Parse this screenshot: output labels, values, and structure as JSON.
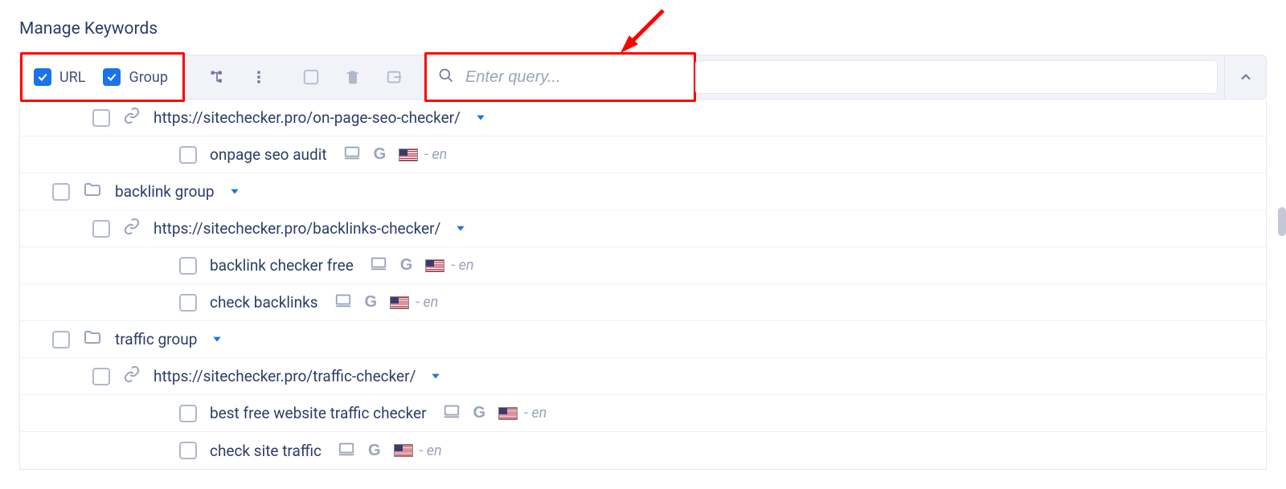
{
  "title": "Manage Keywords",
  "toolbar": {
    "url_label": "URL",
    "group_label": "Group",
    "search_placeholder": "Enter query..."
  },
  "locale_suffix": "- en",
  "tree": [
    {
      "type": "url",
      "label": "https://sitechecker.pro/on-page-seo-checker/",
      "keywords": [
        {
          "text": "onpage seo audit"
        }
      ]
    },
    {
      "type": "group",
      "label": "backlink group",
      "children": [
        {
          "type": "url",
          "label": "https://sitechecker.pro/backlinks-checker/",
          "keywords": [
            {
              "text": "backlink checker free"
            },
            {
              "text": "check backlinks"
            }
          ]
        }
      ]
    },
    {
      "type": "group",
      "label": "traffic group",
      "children": [
        {
          "type": "url",
          "label": "https://sitechecker.pro/traffic-checker/",
          "keywords": [
            {
              "text": "best free website traffic checker"
            },
            {
              "text": "check site traffic"
            }
          ]
        }
      ]
    }
  ]
}
